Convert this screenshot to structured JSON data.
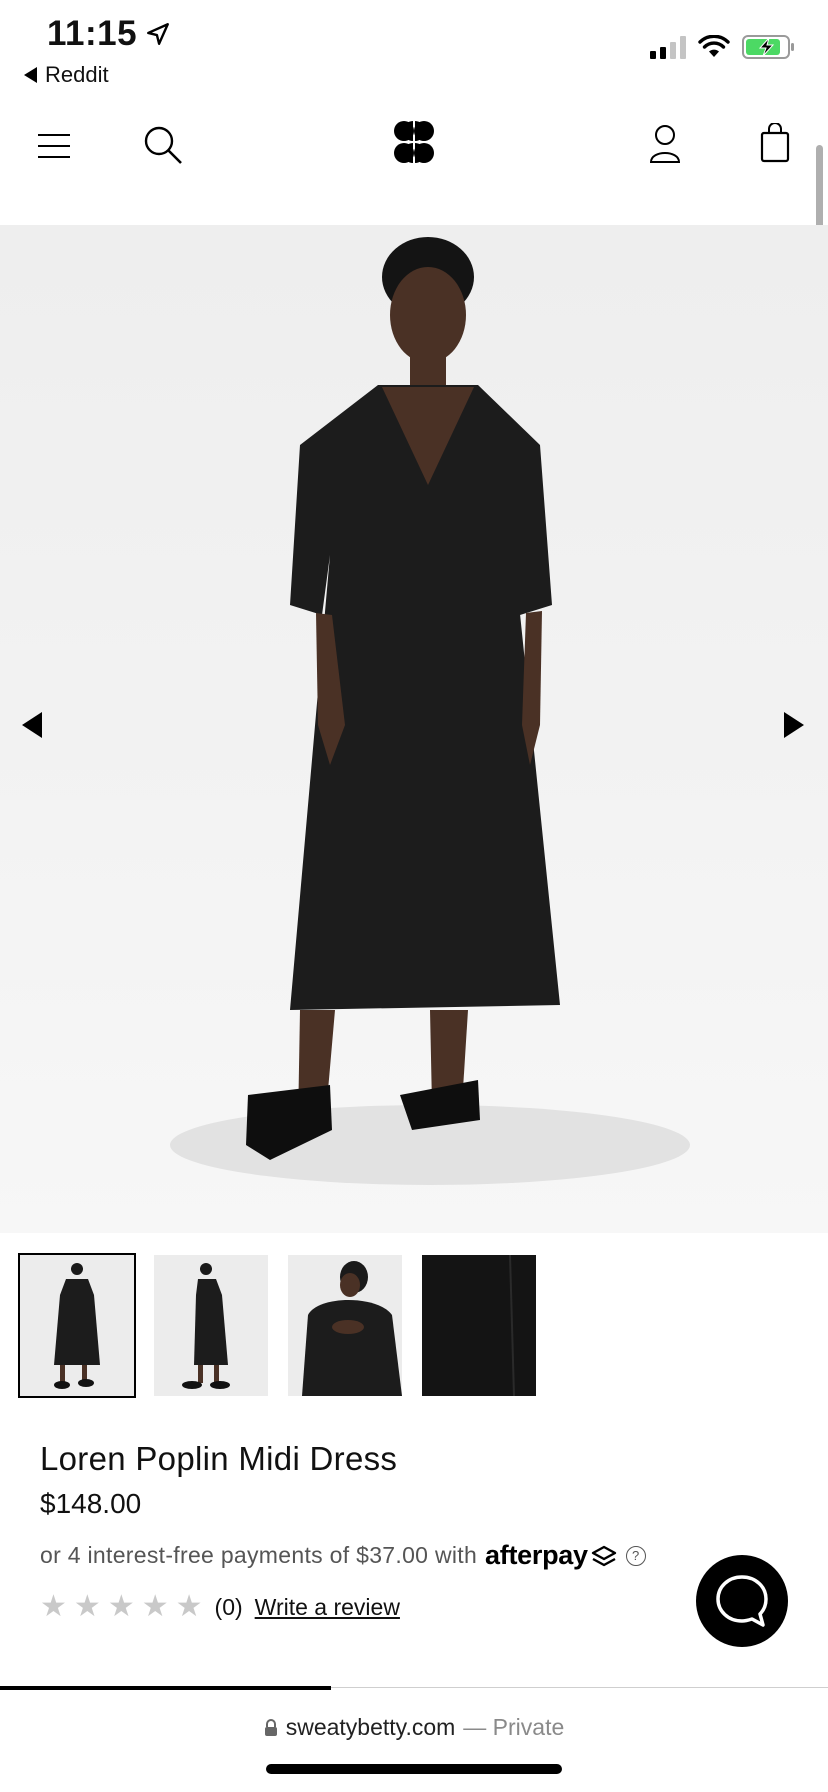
{
  "status_bar": {
    "time": "11:15",
    "back_app": "Reddit",
    "signal_bars": 2,
    "battery_state": "charging"
  },
  "header": {
    "icons": [
      "menu-icon",
      "search-icon",
      "brand-logo",
      "account-icon",
      "bag-icon"
    ]
  },
  "gallery": {
    "thumbnails": [
      "front-view",
      "side-view",
      "back-view",
      "fabric-detail"
    ],
    "active_index": 0
  },
  "product": {
    "title": "Loren Poplin Midi Dress",
    "price": "$148.00",
    "afterpay_text": "or 4 interest-free payments of $37.00 with",
    "afterpay_brand": "afterpay",
    "afterpay_help": "?",
    "rating_stars": 0,
    "review_count": "(0)",
    "write_review": "Write a review"
  },
  "page_progress": 0.4,
  "browser": {
    "domain": "sweatybetty.com",
    "private_label": "— Private"
  },
  "colors": {
    "accent": "#000000",
    "star_empty": "#c9c9c9",
    "battery_green": "#4cd964"
  }
}
